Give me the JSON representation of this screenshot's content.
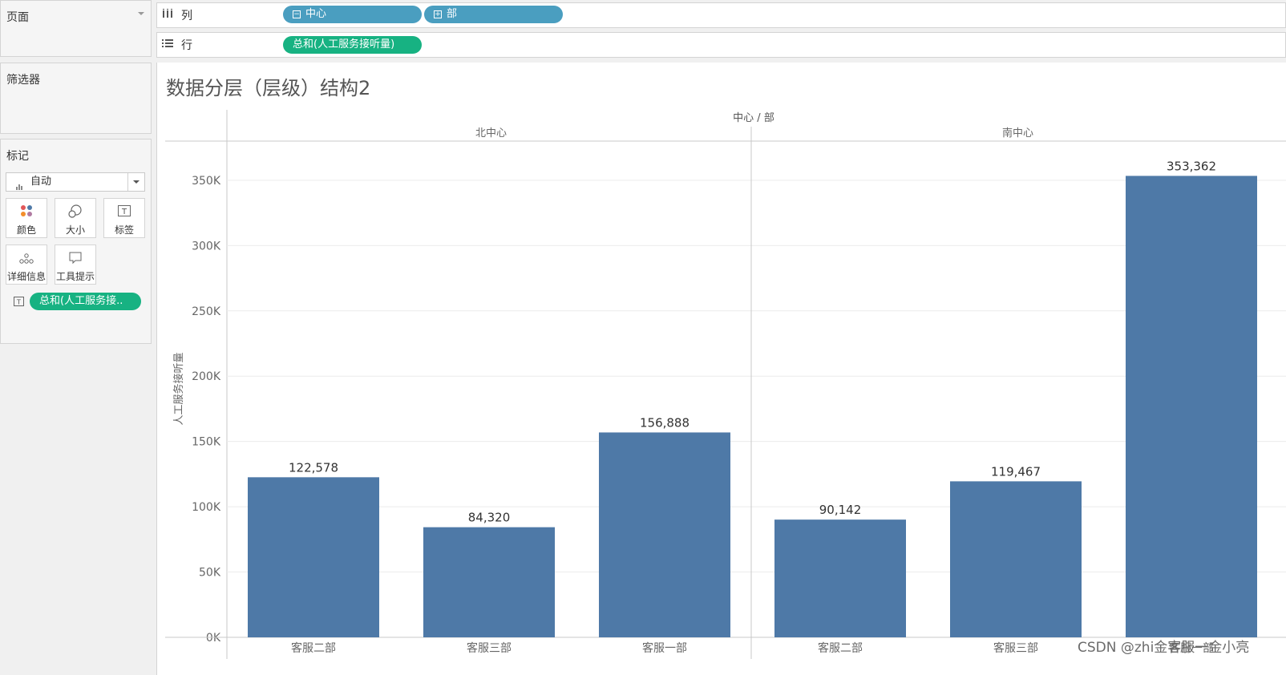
{
  "pages_panel": {
    "title": "页面"
  },
  "filters_panel": {
    "title": "筛选器"
  },
  "marks_panel": {
    "title": "标记",
    "mark_type": "自动",
    "buttons": [
      {
        "label": "颜色",
        "icon": "color-dots-icon"
      },
      {
        "label": "大小",
        "icon": "size-circles-icon"
      },
      {
        "label": "标签",
        "icon": "label-text-icon"
      },
      {
        "label": "详细信息",
        "icon": "detail-dots-icon"
      },
      {
        "label": "工具提示",
        "icon": "tooltip-bubble-icon"
      }
    ],
    "label_field": "总和(人工服务接.."
  },
  "columns_shelf": {
    "label": "列",
    "pills": [
      "中心",
      "部"
    ]
  },
  "rows_shelf": {
    "label": "行",
    "pills": [
      "总和(人工服务接听量)"
    ]
  },
  "sheet": {
    "title": "数据分层（层级）结构2"
  },
  "watermark": "CSDN @zhi金客服一金小亮",
  "chart_data": {
    "type": "bar",
    "header": "中心 / 部",
    "groups": [
      {
        "name": "北中心",
        "categories": [
          "客服二部",
          "客服三部",
          "客服一部"
        ],
        "values": [
          122578,
          84320,
          156888
        ],
        "labels": [
          "122,578",
          "84,320",
          "156,888"
        ]
      },
      {
        "name": "南中心",
        "categories": [
          "客服二部",
          "客服三部",
          "客服一部"
        ],
        "values": [
          90142,
          119467,
          353362
        ],
        "labels": [
          "90,142",
          "119,467",
          "353,362"
        ]
      }
    ],
    "ylabel": "人工服务接听量",
    "ylim": [
      0,
      380000
    ],
    "yticks": [
      0,
      50000,
      100000,
      150000,
      200000,
      250000,
      300000,
      350000
    ],
    "ytick_labels": [
      "0K",
      "50K",
      "100K",
      "150K",
      "200K",
      "250K",
      "300K",
      "350K"
    ],
    "bar_color": "#4e79a7",
    "grid": true
  }
}
